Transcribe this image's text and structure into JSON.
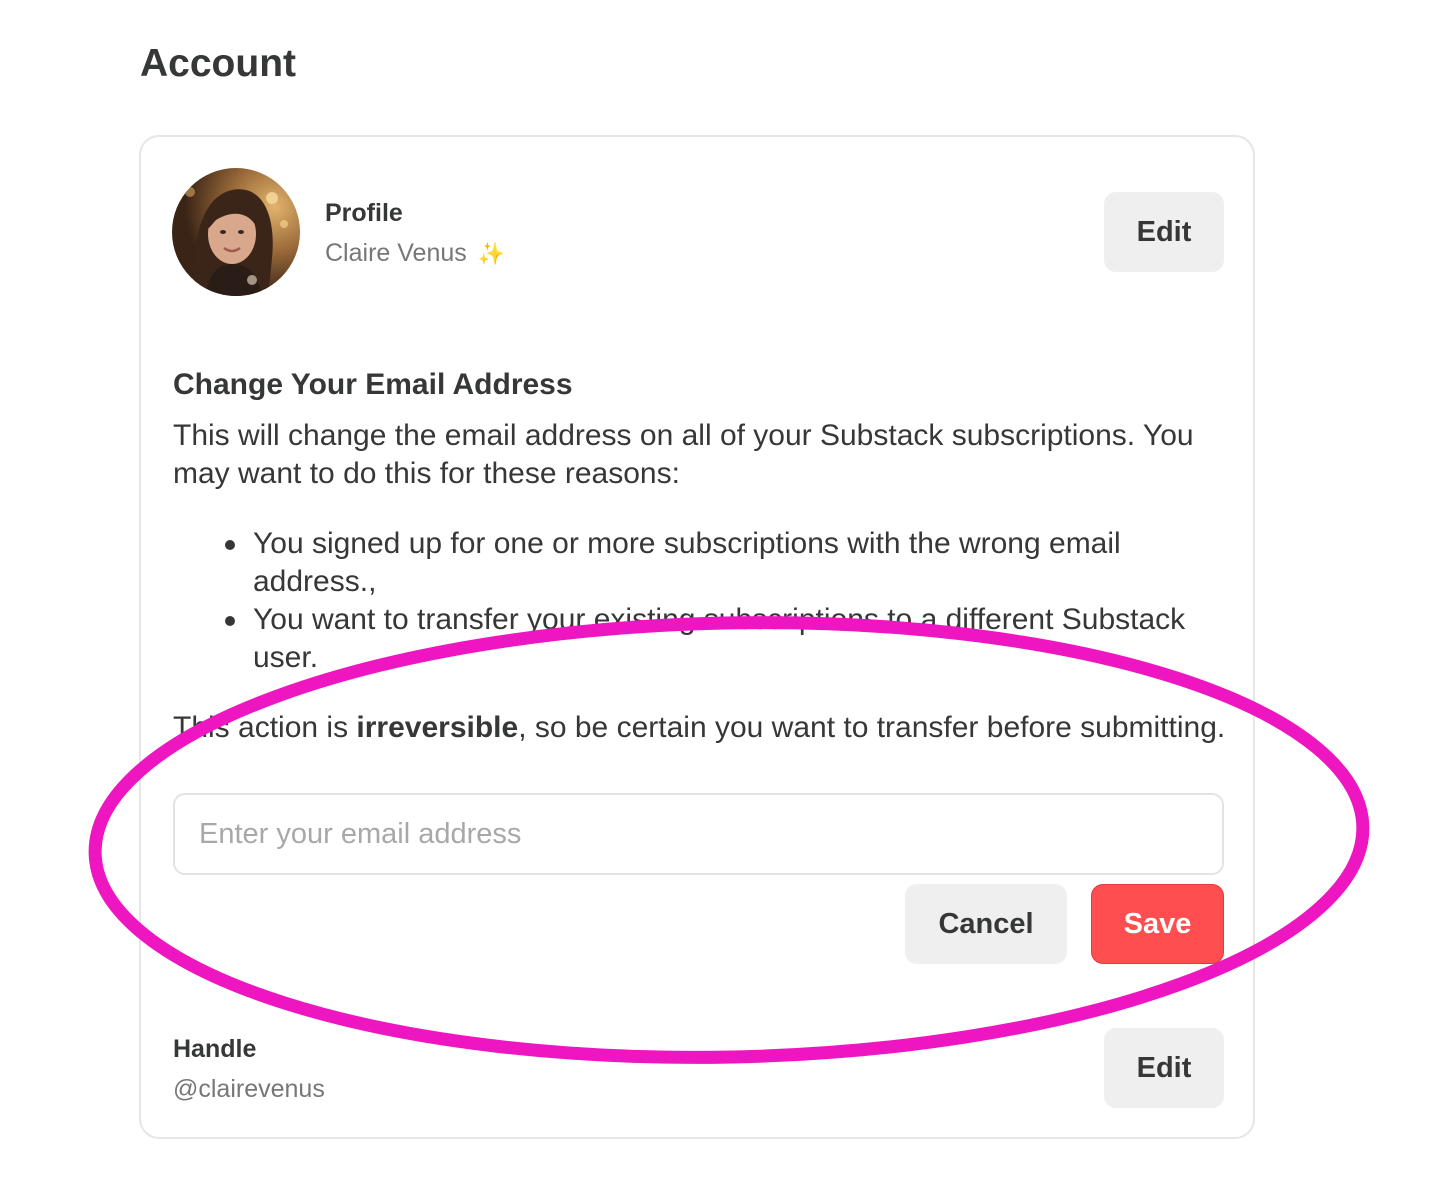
{
  "page": {
    "title": "Account"
  },
  "profile": {
    "label": "Profile",
    "name": "Claire Venus",
    "name_emoji": "✨",
    "edit_label": "Edit"
  },
  "change_email": {
    "heading": "Change Your Email Address",
    "intro": "This will change the email address on all of your Substack subscriptions. You may want to do this for these reasons:",
    "reasons": [
      "You signed up for one or more subscriptions with the wrong email address.,",
      "You want to transfer your existing subscriptions to a different Substack user."
    ],
    "warning_prefix": "This action is ",
    "warning_bold": "irreversible",
    "warning_suffix": ", so be certain you want to transfer before submitting.",
    "email_placeholder": "Enter your email address",
    "email_value": "",
    "cancel_label": "Cancel",
    "save_label": "Save"
  },
  "handle": {
    "label": "Handle",
    "value": "@clairevenus",
    "edit_label": "Edit"
  },
  "colors": {
    "accent_save": "#ff4e50",
    "annotation_ellipse": "#ee16c1",
    "text_primary": "#363737",
    "text_secondary": "#777777"
  },
  "icons": {
    "avatar": "user-photo-avatar"
  }
}
